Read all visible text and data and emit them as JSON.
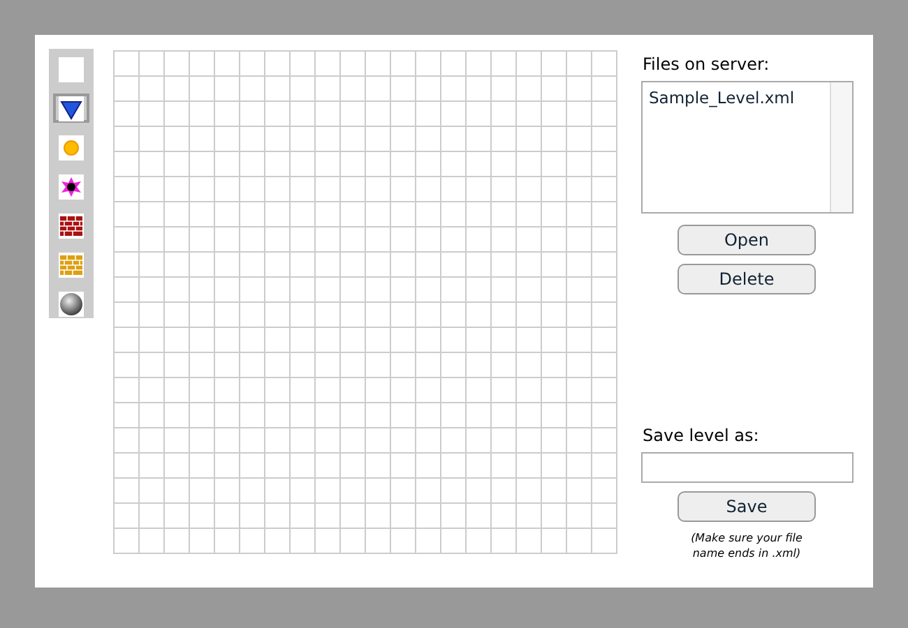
{
  "tools": [
    {
      "kind": "blank",
      "selected": false
    },
    {
      "kind": "triangle",
      "selected": true
    },
    {
      "kind": "coin",
      "selected": false
    },
    {
      "kind": "spike",
      "selected": false
    },
    {
      "kind": "brick",
      "selected": false
    },
    {
      "kind": "goldbrick",
      "selected": false
    },
    {
      "kind": "ball",
      "selected": false
    }
  ],
  "files": {
    "label": "Files on server:",
    "items": [
      {
        "name": "Sample_Level.xml",
        "selected": false
      }
    ]
  },
  "buttons": [
    "Open",
    "Delete"
  ],
  "save": {
    "label": "Save level as:",
    "button": "Save",
    "note": "(Make sure your file name ends in .xml)"
  }
}
